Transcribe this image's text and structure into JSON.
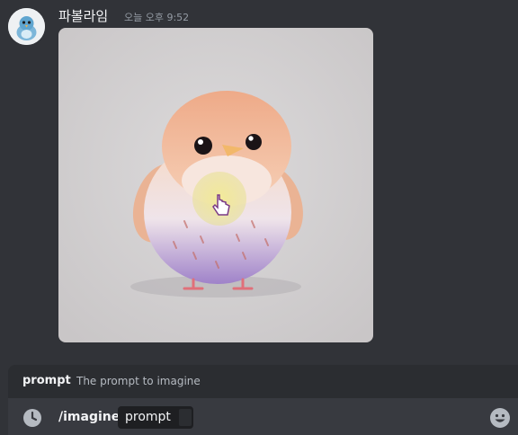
{
  "message": {
    "username": "파볼라임",
    "timestamp": "오늘 오후 9:52",
    "avatar_icon": "bird-avatar-icon"
  },
  "suggestion": {
    "option_name": "prompt",
    "option_description": "The prompt to imagine"
  },
  "composer": {
    "command": "/imagine",
    "option_label": "prompt",
    "option_value": "",
    "left_icon": "clock-icon",
    "right_icon": "emoji-icon"
  },
  "colors": {
    "background": "#313338",
    "suggest_bar": "#2b2d31",
    "composer": "#383a40",
    "pill": "#1e1f22"
  }
}
